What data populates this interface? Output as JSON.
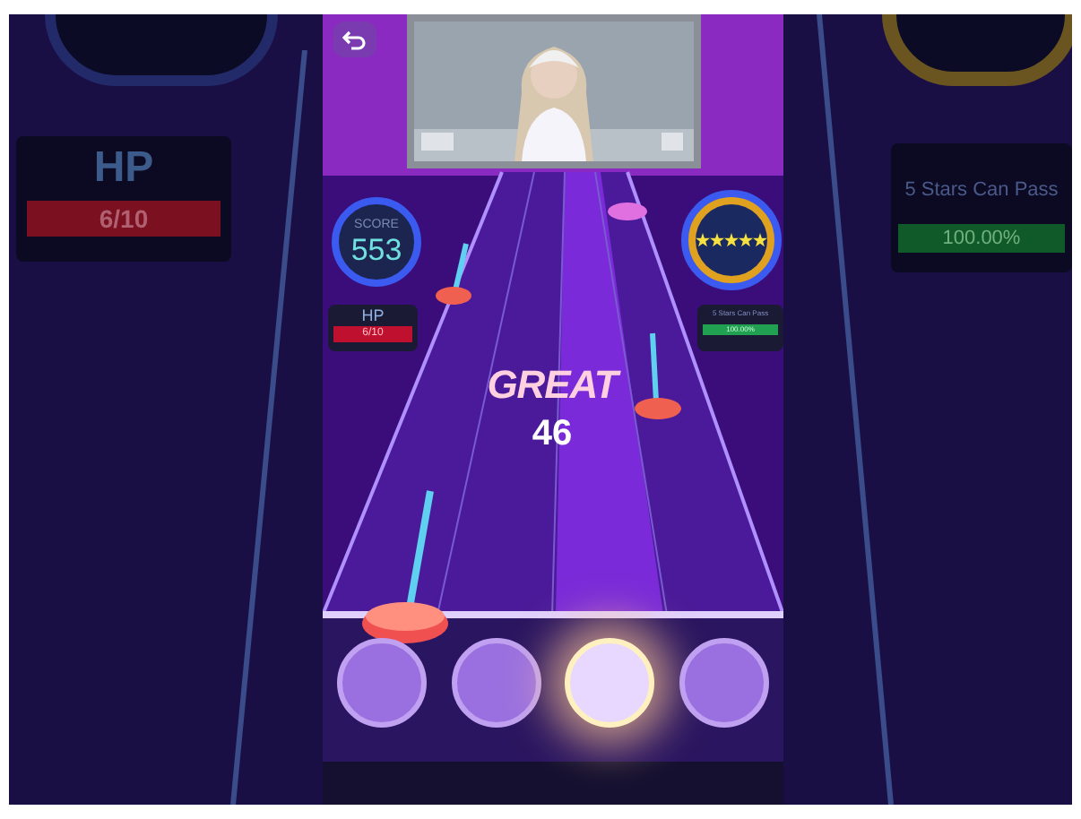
{
  "side_left": {
    "hp_label": "HP",
    "hp_value": "6/10"
  },
  "side_right": {
    "goal_label": "5 Stars Can Pass",
    "goal_value": "100.00%"
  },
  "score": {
    "label": "SCORE",
    "value": "553"
  },
  "hp": {
    "label": "HP",
    "value": "6/10"
  },
  "star_meter": {
    "stars": 5
  },
  "goal": {
    "label": "5 Stars Can Pass",
    "value": "100.00%"
  },
  "judgement": {
    "text": "GREAT",
    "combo": "46"
  },
  "lanes": [
    {
      "pressed": false
    },
    {
      "pressed": false
    },
    {
      "pressed": true
    },
    {
      "pressed": false
    }
  ]
}
